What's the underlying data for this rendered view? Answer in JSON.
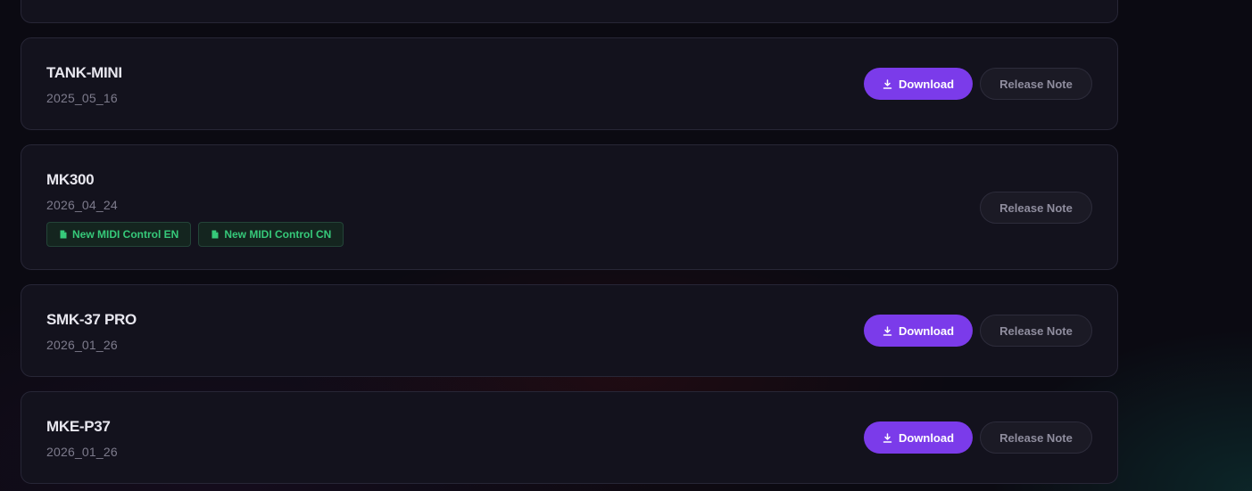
{
  "labels": {
    "download": "Download",
    "release_note": "Release Note"
  },
  "firmware": [
    {
      "name": "TANK-MINI",
      "date": "2025_05_16"
    },
    {
      "name": "MK300",
      "date": "2026_04_24",
      "tags": [
        "New MIDI Control EN",
        "New MIDI Control CN"
      ]
    },
    {
      "name": "SMK-37 PRO",
      "date": "2026_01_26"
    },
    {
      "name": "MKE-P37",
      "date": "2026_01_26"
    }
  ],
  "icons": {
    "download": "download-icon",
    "document": "document-icon"
  },
  "colors": {
    "accent": "#7b3bea",
    "tag_text": "#36c97a",
    "card_bg": "#13121d",
    "page_bg": "#0b0a12"
  }
}
